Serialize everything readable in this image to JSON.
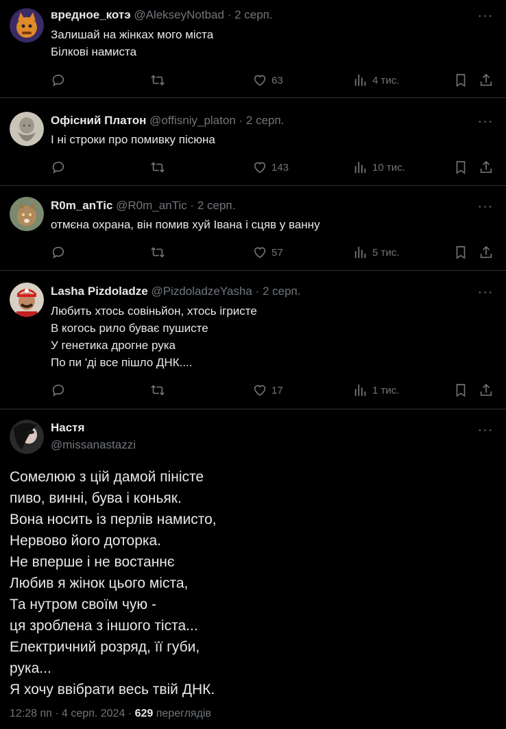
{
  "tweets": [
    {
      "name": "вредное_котэ",
      "handle": "@AlekseyNotbad",
      "dot": "·",
      "date": "2 серп.",
      "more": "···",
      "lines": [
        "Залишай на жінках мого міста",
        "Білкові намиста"
      ],
      "likes": "63",
      "views": "4 тис."
    },
    {
      "name": "Офісний Платон",
      "handle": "@offisniy_platon",
      "dot": "·",
      "date": "2 серп.",
      "more": "···",
      "lines": [
        "І ні строки про помивку пісюна"
      ],
      "likes": "143",
      "views": "10 тис."
    },
    {
      "name": "R0m_anTic",
      "handle": "@R0m_anTic",
      "dot": "·",
      "date": "2 серп.",
      "more": "···",
      "lines": [
        "отмєна охрана, він помив хуй Івана і сцяв у ванну"
      ],
      "likes": "57",
      "views": "5 тис."
    },
    {
      "name": "Lasha Pizdoladze",
      "handle": "@PizdoladzeYasha",
      "dot": "·",
      "date": "2 серп.",
      "more": "···",
      "lines": [
        "Любить хтось совіньйон, хтось ігристе",
        "В когось рило буває пушисте",
        "У генетика дрогне рука",
        "По пи 'ді все пішло ДНК...."
      ],
      "likes": "17",
      "views": "1 тис."
    }
  ],
  "main": {
    "name": "Настя",
    "handle": "@missanastazzi",
    "more": "···",
    "lines": [
      "Сомелюю з цій дамой піністе",
      "пиво, винні, бува і коньяк.",
      "Вона носить із перлів намисто,",
      "Нервово його доторка.",
      "Не вперше і не востаннє",
      "Любив я жінок цього міста,",
      "Та нутром своїм чую -",
      "ця зроблена з іншого тіста...",
      "Електричний розряд, її губи,",
      "рука...",
      "Я хочу ввібрати весь твій ДНК."
    ],
    "time": "12:28 пп",
    "sep1": "·",
    "date": "4 серп. 2024",
    "sep2": "·",
    "views_count": "629",
    "views_label": "переглядів"
  },
  "icons": {
    "reply": "reply-icon",
    "retweet": "retweet-icon",
    "like": "heart-icon",
    "views": "views-icon",
    "bookmark": "bookmark-icon",
    "share": "share-icon",
    "more": "more-icon"
  },
  "colors": {
    "background": "#000000",
    "text": "#e7e9ea",
    "muted": "#71767b",
    "divider": "#2f3336"
  }
}
